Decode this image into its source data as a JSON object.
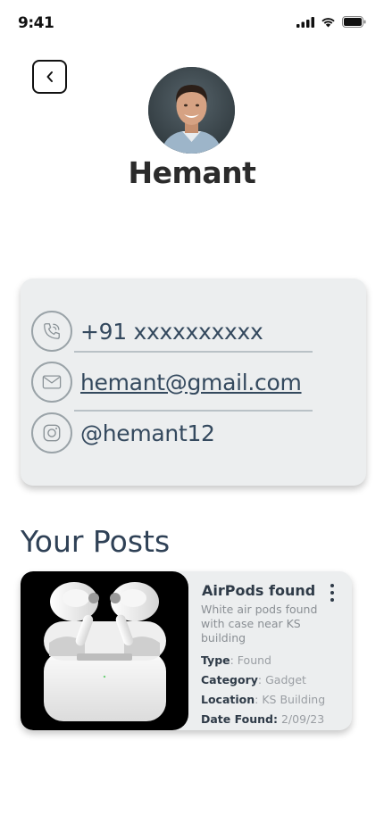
{
  "status_bar": {
    "time": "9:41"
  },
  "profile": {
    "name": "Hemant"
  },
  "contacts": [
    {
      "icon": "phone-icon",
      "text": "+91 xxxxxxxxxx"
    },
    {
      "icon": "mail-icon",
      "text": "hemant@gmail.com"
    },
    {
      "icon": "instagram-icon",
      "text": "@hemant12"
    }
  ],
  "posts_section": {
    "title": "Your Posts",
    "posts": [
      {
        "title": "AirPods found",
        "description": "White air pods found with case near KS building",
        "type_label": "Type",
        "type_value": ": Found",
        "category_label": "Category",
        "category_value": ": Gadget",
        "location_label": "Location",
        "location_value": ": KS Building",
        "date_label": "Date Found:",
        "date_value": " 2/09/23"
      }
    ]
  }
}
